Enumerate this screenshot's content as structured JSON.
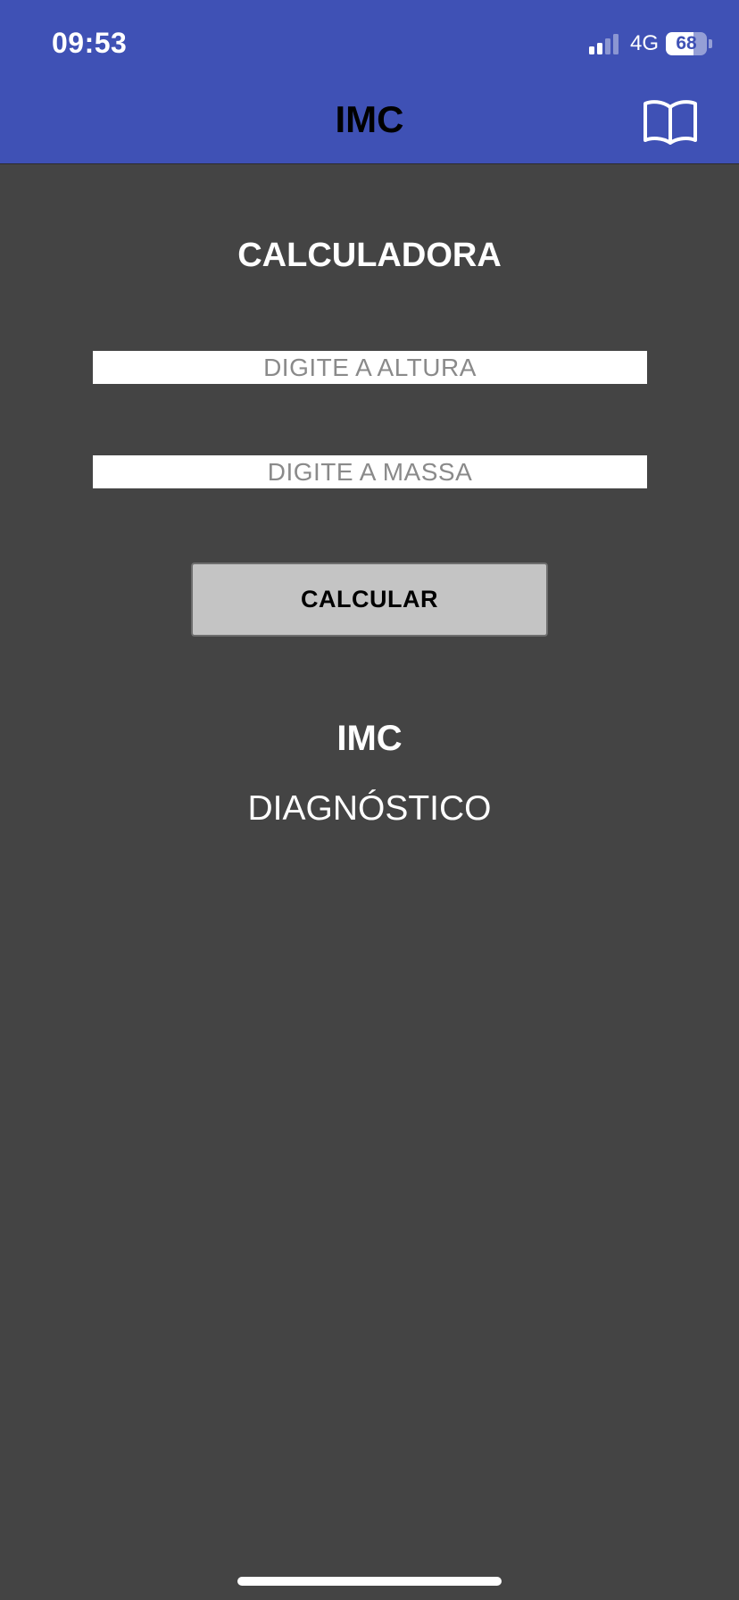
{
  "status_bar": {
    "time": "09:53",
    "network": "4G",
    "battery_level": "68",
    "battery_fraction": 0.68,
    "signal_bars_active": 2,
    "signal_bars_total": 4
  },
  "header": {
    "title": "IMC",
    "icon": "book-icon",
    "background_color": "#3F51B5"
  },
  "main": {
    "section_title": "CALCULADORA",
    "height_input": {
      "value": "",
      "placeholder": "DIGITE A ALTURA"
    },
    "mass_input": {
      "value": "",
      "placeholder": "DIGITE A MASSA"
    },
    "calculate_button_label": "CALCULAR",
    "result_label": "IMC",
    "diagnosis_label": "DIAGNÓSTICO",
    "background_color": "#444444"
  }
}
